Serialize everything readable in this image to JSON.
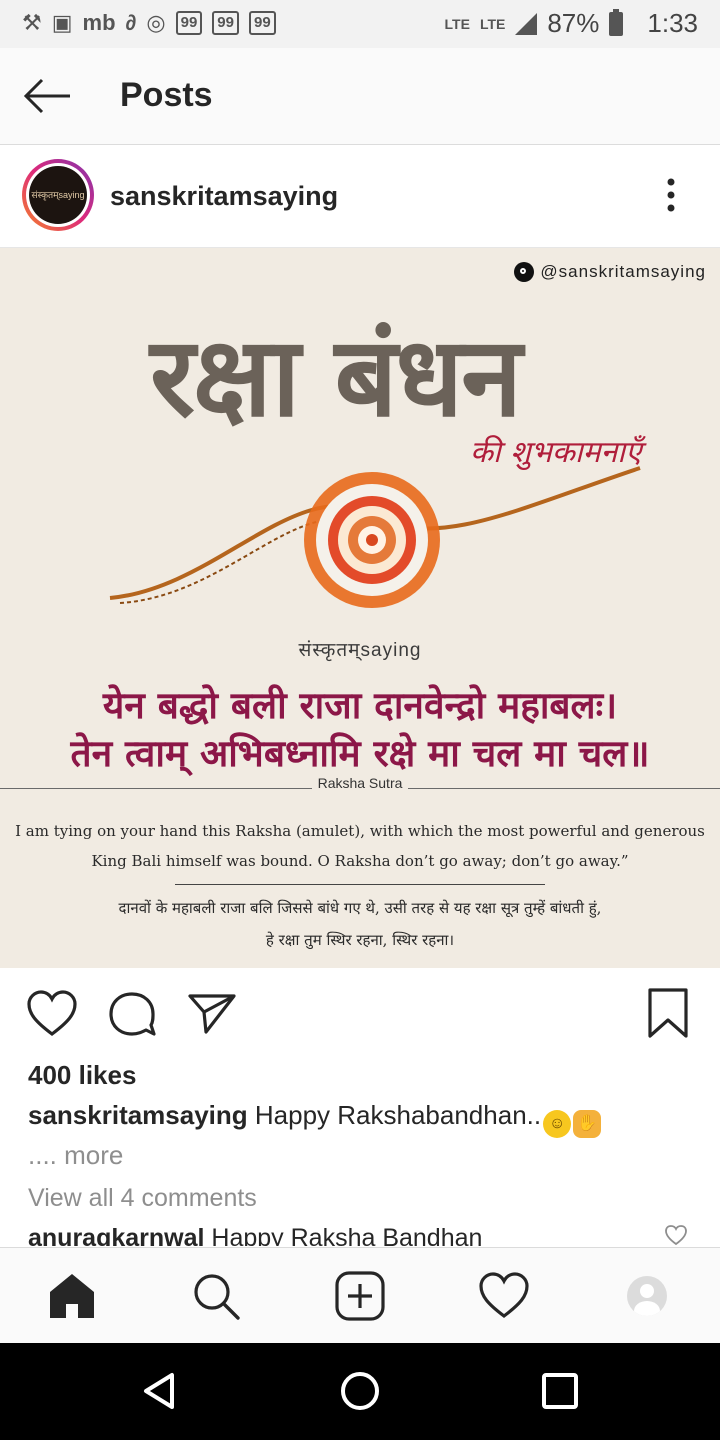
{
  "status_bar": {
    "left_icons": [
      "settings-icon",
      "shopping-icon",
      "mb-icon",
      "link-icon",
      "app-icon"
    ],
    "badges": [
      "99",
      "99",
      "99"
    ],
    "network1": "LTE",
    "network2": "LTE",
    "battery": "87%",
    "time": "1:33"
  },
  "header": {
    "title": "Posts"
  },
  "post": {
    "username": "sanskritamsaying",
    "avatar_text": "संस्कृतम्saying",
    "image": {
      "handle": "@sanskritamsaying",
      "title": "रक्षा बंधन",
      "subtitle": "की शुभकामनाएँ",
      "brand": "संस्कृतम्saying",
      "shloka_line1": "येन बद्धो बली राजा दानवेन्द्रो महाबलः।",
      "shloka_line2": "तेन त्वाम् अभिबध्नामि रक्षे मा चल मा चल॥",
      "label": "Raksha Sutra",
      "english_line1": "I am tying on your hand this Raksha (amulet), with which the most powerful and generous",
      "english_line2": "King Bali himself was bound. O Raksha don’t go away; don’t go away.”",
      "hindi_line1": "दानवों के महाबली राजा बलि जिससे बांधे गए थे, उसी तरह से यह रक्षा सूत्र तुम्हें बांधती हुं,",
      "hindi_line2": "हे रक्षा तुम स्थिर रहना, स्थिर रहना।"
    },
    "likes": "400 likes",
    "caption_user": "sanskritamsaying",
    "caption_text": " Happy Rakshabandhan..",
    "more": ".... more",
    "view_comments": "View all 4 comments",
    "comment_user": "anuragkarnwal",
    "comment_text": " Happy Raksha Bandhan"
  },
  "colors": {
    "accent_text": "#262626",
    "muted_text": "#8e8e8e",
    "shloka": "#8c1748",
    "title": "#6b6259"
  }
}
